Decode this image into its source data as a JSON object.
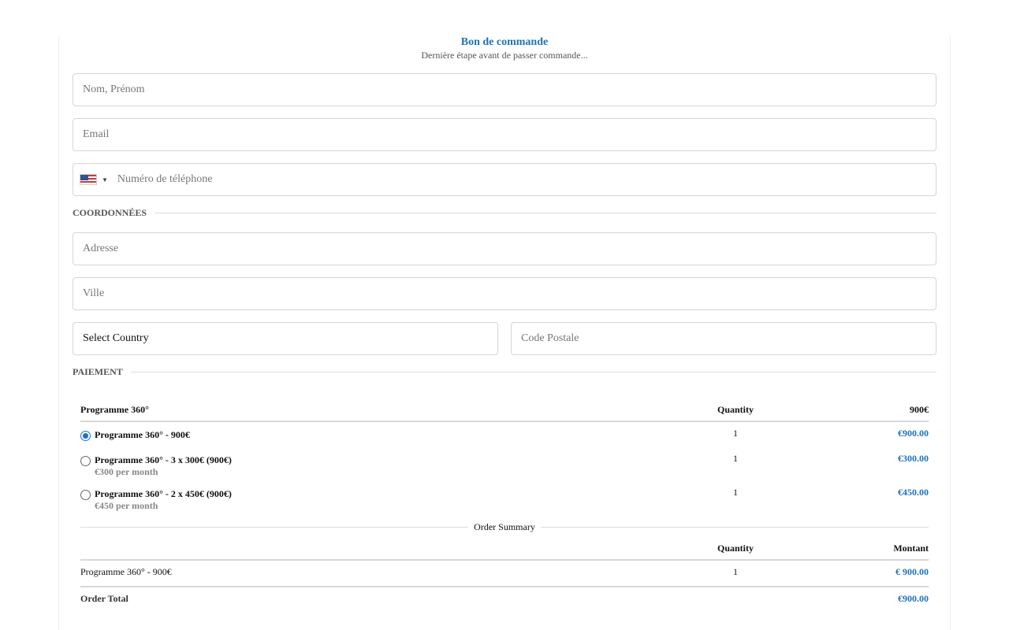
{
  "header": {
    "title": "Bon de commande",
    "subtitle": "Dernière étape avant de passer commande..."
  },
  "form": {
    "name_placeholder": "Nom, Prénom",
    "email_placeholder": "Email",
    "phone_placeholder": "Numéro de téléphone",
    "phone_country_flag": "us-flag-icon",
    "section_coords": "COORDONNÉES",
    "address_placeholder": "Adresse",
    "city_placeholder": "Ville",
    "country_selected": "Select Country",
    "postal_placeholder": "Code Postale",
    "section_payment": "PAIEMENT"
  },
  "products": {
    "header": {
      "name": "Programme 360°",
      "quantity": "Quantity",
      "price": "900€"
    },
    "items": [
      {
        "label": "Programme 360° - 900€",
        "sub": "",
        "quantity": "1",
        "amount": "€900.00",
        "selected": true
      },
      {
        "label": "Programme 360° - 3 x 300€ (900€)",
        "sub": "€300 per month",
        "quantity": "1",
        "amount": "€300.00",
        "selected": false
      },
      {
        "label": "Programme 360° - 2 x 450€ (900€)",
        "sub": "€450 per month",
        "quantity": "1",
        "amount": "€450.00",
        "selected": false
      }
    ]
  },
  "summary": {
    "title": "Order Summary",
    "col_quantity": "Quantity",
    "col_amount": "Montant",
    "row": {
      "label": "Programme 360° - 900€",
      "quantity": "1",
      "amount": "€ 900.00"
    },
    "total_label": "Order Total",
    "total_amount": "€900.00"
  },
  "colors": {
    "accent": "#1f72b8",
    "radio": "#1a6fd0",
    "border": "#d6d6d6"
  }
}
